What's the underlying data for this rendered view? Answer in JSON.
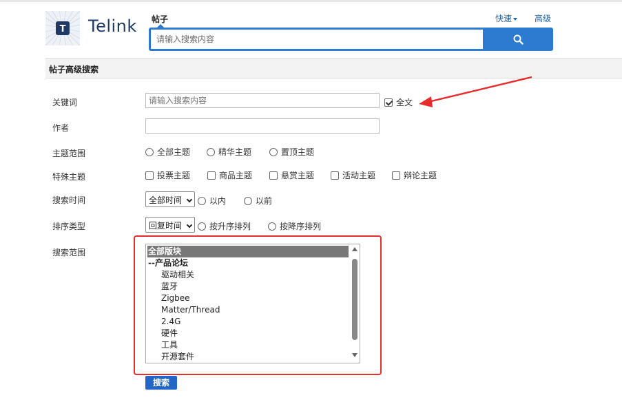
{
  "header": {
    "logo_text": "Telink",
    "logo_letter": "T",
    "search_tab": "帖子",
    "quick_link": "快速",
    "advanced_link": "高级",
    "search_placeholder": "请输入搜索内容"
  },
  "section_title": "帖子高级搜索",
  "form": {
    "keyword_label": "关键词",
    "keyword_placeholder": "请输入搜索内容",
    "fulltext_label": "全文",
    "fulltext_checked": true,
    "author_label": "作者",
    "topic_scope_label": "主题范围",
    "topic_scope_options": [
      "全部主题",
      "精华主题",
      "置顶主题"
    ],
    "special_label": "特殊主题",
    "special_options": [
      "投票主题",
      "商品主题",
      "悬赏主题",
      "活动主题",
      "辩论主题"
    ],
    "time_label": "搜索时间",
    "time_select": "全部时间",
    "time_options": [
      "以内",
      "以前"
    ],
    "sort_label": "排序类型",
    "sort_select": "回复时间",
    "sort_options": [
      "按升序排列",
      "按降序排列"
    ],
    "range_label": "搜索范围",
    "range_items": [
      {
        "text": "全部版块",
        "kind": "selected"
      },
      {
        "text": "--产品论坛",
        "kind": "group"
      },
      {
        "text": "驱动相关",
        "kind": "child"
      },
      {
        "text": "蓝牙",
        "kind": "child"
      },
      {
        "text": "Zigbee",
        "kind": "child"
      },
      {
        "text": "Matter/Thread",
        "kind": "child"
      },
      {
        "text": "2.4G",
        "kind": "child"
      },
      {
        "text": "硬件",
        "kind": "child"
      },
      {
        "text": "工具",
        "kind": "child"
      },
      {
        "text": "开源套件",
        "kind": "child"
      }
    ],
    "submit_label": "搜索"
  },
  "colors": {
    "accent": "#2d7bd0",
    "annotation": "#e82b2b"
  }
}
